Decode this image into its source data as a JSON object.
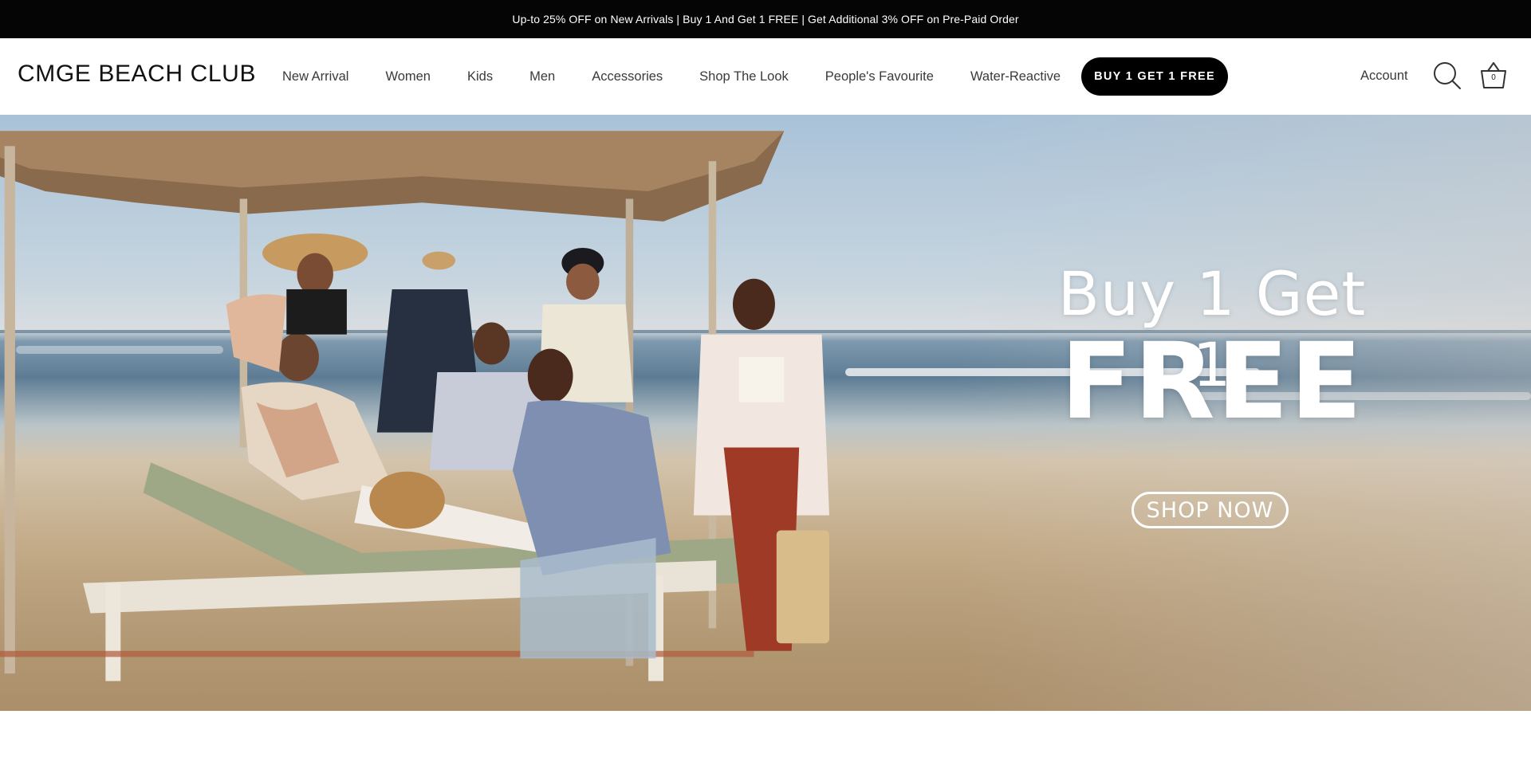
{
  "announcement": {
    "text": "Up-to 25% OFF on New Arrivals | Buy 1 And Get 1 FREE | Get Additional 3% OFF on Pre-Paid Order"
  },
  "header": {
    "logo": "CMGE BEACH CLUB",
    "nav": [
      {
        "label": "New Arrival"
      },
      {
        "label": "Women"
      },
      {
        "label": "Kids"
      },
      {
        "label": "Men"
      },
      {
        "label": "Accessories"
      },
      {
        "label": "Shop The Look"
      },
      {
        "label": "People's Favourite"
      },
      {
        "label": "Water-Reactive"
      }
    ],
    "promo_button": "BUY 1 GET 1 FREE",
    "account": "Account",
    "cart_count": "0"
  },
  "hero": {
    "line1": "Buy 1 Get 1",
    "line2": "FREE",
    "cta": "SHOP NOW"
  },
  "colors": {
    "announcement_bg": "#050505",
    "button_bg": "#000000",
    "text": "#3a3a3a"
  },
  "icons": {
    "search": "search-icon",
    "cart": "basket-icon"
  }
}
